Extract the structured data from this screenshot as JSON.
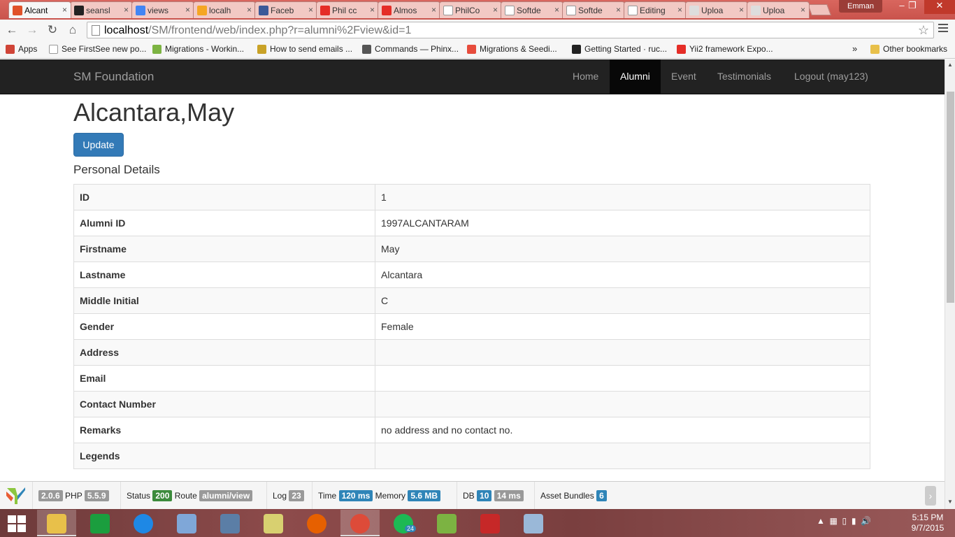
{
  "browser": {
    "tabs": [
      {
        "label": "Alcant",
        "icon": "xampp-icon",
        "color": "#e0522a",
        "active": true
      },
      {
        "label": "seansl",
        "icon": "github-icon",
        "color": "#222222"
      },
      {
        "label": "views",
        "icon": "google-icon",
        "color": "#4285f4"
      },
      {
        "label": "localh",
        "icon": "phpmyadmin-icon",
        "color": "#f5a623"
      },
      {
        "label": "Faceb",
        "icon": "facebook-icon",
        "color": "#3b5998"
      },
      {
        "label": "Phil cc",
        "icon": "youtube-icon",
        "color": "#e52d27"
      },
      {
        "label": "Almos",
        "icon": "youtube-icon",
        "color": "#e52d27"
      },
      {
        "label": "PhilCo",
        "icon": "page-icon",
        "color": "#ffffff"
      },
      {
        "label": "Softde",
        "icon": "page-icon",
        "color": "#ffffff"
      },
      {
        "label": "Softde",
        "icon": "page-icon",
        "color": "#ffffff"
      },
      {
        "label": "Editing",
        "icon": "page-icon",
        "color": "#ffffff"
      },
      {
        "label": "Uploa",
        "icon": "camera-icon",
        "color": "#dddddd"
      },
      {
        "label": "Uploa",
        "icon": "camera-icon",
        "color": "#dddddd"
      }
    ],
    "profile_name": "Emman",
    "url_host": "localhost",
    "url_path": "/SM/frontend/web/index.php?r=alumni%2Fview&id=1",
    "bookmarks": [
      {
        "label": "Apps",
        "icon": "apps-grid-icon",
        "color": "#d04437"
      },
      {
        "label": "See FirstSee new po...",
        "icon": "page-icon",
        "color": "#ffffff"
      },
      {
        "label": "Migrations - Workin...",
        "icon": "phinx-icon",
        "color": "#7cb342"
      },
      {
        "label": "How to send emails ...",
        "icon": "phinx-icon",
        "color": "#c9a227"
      },
      {
        "label": "Commands — Phinx...",
        "icon": "doc-icon",
        "color": "#555555"
      },
      {
        "label": "Migrations & Seedi...",
        "icon": "laravel-icon",
        "color": "#e74c3c"
      },
      {
        "label": "Getting Started · ruc...",
        "icon": "github-icon",
        "color": "#222222"
      },
      {
        "label": "Yii2 framework Expo...",
        "icon": "youtube-icon",
        "color": "#e52d27"
      }
    ],
    "bookmarks_overflow": "»",
    "other_bookmarks": "Other bookmarks"
  },
  "navbar": {
    "brand": "SM Foundation",
    "links": [
      "Home",
      "Alumni",
      "Event",
      "Testimonials",
      "Logout (may123)"
    ],
    "active_link": "Alumni"
  },
  "page": {
    "title": "Alcantara,May",
    "update_button": "Update",
    "section_title": "Personal Details",
    "details": [
      {
        "label": "ID",
        "value": "1"
      },
      {
        "label": "Alumni ID",
        "value": "1997ALCANTARAM"
      },
      {
        "label": "Firstname",
        "value": "May"
      },
      {
        "label": "Lastname",
        "value": "Alcantara"
      },
      {
        "label": "Middle Initial",
        "value": "C"
      },
      {
        "label": "Gender",
        "value": "Female"
      },
      {
        "label": "Address",
        "value": ""
      },
      {
        "label": "Email",
        "value": ""
      },
      {
        "label": "Contact Number",
        "value": ""
      },
      {
        "label": "Remarks",
        "value": "no address and no contact no."
      },
      {
        "label": "Legends",
        "value": ""
      }
    ]
  },
  "debug": {
    "yii_version": "2.0.6",
    "php_label": "PHP",
    "php_version": "5.5.9",
    "status_label": "Status",
    "status": "200",
    "route_label": "Route",
    "route": "alumni/view",
    "log_label": "Log",
    "log": "23",
    "time_label": "Time",
    "time": "120 ms",
    "memory_label": "Memory",
    "memory": "5.6 MB",
    "db_label": "DB",
    "db_queries": "10",
    "db_time": "14 ms",
    "assets_label": "Asset Bundles",
    "assets": "6",
    "toggle": "›"
  },
  "taskbar": {
    "apps": [
      {
        "name": "file-explorer-icon",
        "color": "#e8c04a",
        "active": true
      },
      {
        "name": "store-icon",
        "color": "#1b9e3e"
      },
      {
        "name": "internet-explorer-icon",
        "color": "#1e88e5"
      },
      {
        "name": "virtualbox-icon",
        "color": "#7fa7d8"
      },
      {
        "name": "virtualbox-manager-icon",
        "color": "#5b7ea6"
      },
      {
        "name": "folder-notes-icon",
        "color": "#d8d070"
      },
      {
        "name": "firefox-icon",
        "color": "#e66000"
      },
      {
        "name": "chrome-icon",
        "color": "#dd4b39",
        "active": true
      },
      {
        "name": "spotify-icon",
        "color": "#1db954"
      },
      {
        "name": "notepad-plus-icon",
        "color": "#7cb342"
      },
      {
        "name": "acrobat-icon",
        "color": "#c62828"
      },
      {
        "name": "paint-icon",
        "color": "#9ab8d8"
      }
    ],
    "spotify_badge": "24",
    "time": "5:15 PM",
    "date": "9/7/2015"
  }
}
